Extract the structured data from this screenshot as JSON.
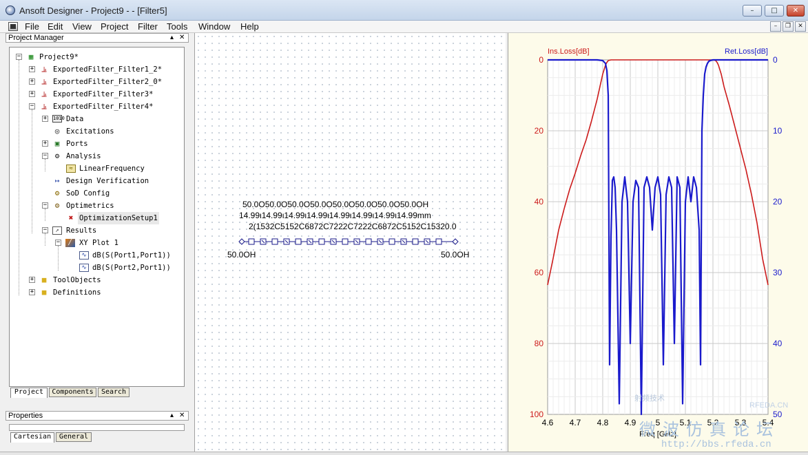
{
  "window": {
    "title": "Ansoft Designer - Project9 -  - [Filter5]"
  },
  "menu": [
    "File",
    "Edit",
    "View",
    "Project",
    "Filter",
    "Tools",
    "Window",
    "Help"
  ],
  "project_manager": {
    "title": "Project Manager",
    "tree": [
      {
        "label": "Project9*",
        "icon": "project-icon"
      },
      {
        "label": "ExportedFilter_Filter1_2*",
        "icon": "filter-icon"
      },
      {
        "label": "ExportedFilter_Filter2_0*",
        "icon": "filter-icon"
      },
      {
        "label": "ExportedFilter_Filter3*",
        "icon": "filter-icon"
      },
      {
        "label": "ExportedFilter_Filter4*",
        "icon": "filter-icon"
      },
      {
        "label": "Data",
        "icon": "data-icon"
      },
      {
        "label": "Excitations",
        "icon": "excitation-icon"
      },
      {
        "label": "Ports",
        "icon": "ports-icon"
      },
      {
        "label": "Analysis",
        "icon": "analysis-gear-icon"
      },
      {
        "label": "LinearFrequency",
        "icon": "sweep-icon"
      },
      {
        "label": "Design Verification",
        "icon": "verification-icon"
      },
      {
        "label": "SoD Config",
        "icon": "config-icon"
      },
      {
        "label": "Optimetrics",
        "icon": "optimetrics-icon"
      },
      {
        "label": "OptimizationSetup1",
        "icon": "optimization-icon"
      },
      {
        "label": "Results",
        "icon": "results-icon"
      },
      {
        "label": "XY Plot 1",
        "icon": "xy-plot-icon"
      },
      {
        "label": "dB(S(Port1,Port1))",
        "icon": "trace-icon"
      },
      {
        "label": "dB(S(Port2,Port1))",
        "icon": "trace-icon"
      },
      {
        "label": "ToolObjects",
        "icon": "folder-icon"
      },
      {
        "label": "Definitions",
        "icon": "folder-icon"
      }
    ],
    "tabs": [
      "Project",
      "Components",
      "Search"
    ]
  },
  "properties": {
    "title": "Properties",
    "tabs": [
      "Cartesian",
      "General"
    ]
  },
  "schematic": {
    "line1": "50.0O50.0O50.0O50.0O50.0O50.0O50.0O50.0OH",
    "line2": "14.99ι14.99ι14.99ι14.99ι14.99ι14.99ι14.99ι14.99mm",
    "line3": "2(1532C5152C6872C7222C7222C6872C5152C15320.0",
    "port_left": "50.0OH",
    "port_right": "50.0OH"
  },
  "chart_data": {
    "type": "line",
    "xlabel": "Freq [GHz]",
    "ylabel_left": "Ins.Loss[dB]",
    "ylabel_right": "Ret.Loss[dB]",
    "x_ticks": [
      "4.6",
      "4.7",
      "4.8",
      "4.9",
      "5",
      "5.1",
      "5.2",
      "5.3",
      "5.4"
    ],
    "y_left_ticks": [
      "0",
      "20",
      "40",
      "60",
      "80",
      "100"
    ],
    "y_right_ticks": [
      "0",
      "10",
      "20",
      "30",
      "40",
      "50"
    ],
    "xlim": [
      4.6,
      5.4
    ],
    "ylim_left": [
      0,
      100
    ],
    "ylim_right": [
      0,
      50
    ],
    "grid": true,
    "series": [
      {
        "name": "Ins.Loss[dB]",
        "color": "#cc1a1a",
        "axis": "left",
        "x": [
          4.6,
          4.62,
          4.64,
          4.66,
          4.68,
          4.7,
          4.72,
          4.74,
          4.76,
          4.78,
          4.79,
          4.8,
          4.81,
          4.815,
          4.82,
          4.83,
          5.2,
          5.21,
          5.215,
          5.22,
          5.23,
          5.24,
          5.26,
          5.28,
          5.3,
          5.32,
          5.34,
          5.36,
          5.38,
          5.4
        ],
        "y": [
          63.5,
          56,
          48,
          42,
          36.5,
          32,
          27,
          22.5,
          17,
          11,
          7.5,
          4,
          1.5,
          0.7,
          0.2,
          0,
          0,
          0.2,
          0.7,
          1.5,
          4,
          7.5,
          13,
          19,
          25,
          31,
          38,
          46,
          56,
          63.5
        ]
      },
      {
        "name": "Ret.Loss[dB]",
        "color": "#1a1acc",
        "axis": "right",
        "x": [
          4.6,
          4.78,
          4.8,
          4.81,
          4.815,
          4.82,
          4.825,
          4.83,
          4.835,
          4.84,
          4.845,
          4.85,
          4.86,
          4.87,
          4.88,
          4.89,
          4.9,
          4.91,
          4.92,
          4.93,
          4.94,
          4.95,
          4.96,
          4.97,
          4.98,
          4.99,
          5.0,
          5.01,
          5.02,
          5.03,
          5.04,
          5.05,
          5.06,
          5.07,
          5.08,
          5.09,
          5.1,
          5.11,
          5.12,
          5.13,
          5.14,
          5.15,
          5.155,
          5.16,
          5.165,
          5.17,
          5.175,
          5.18,
          5.185,
          5.19,
          5.2,
          5.22,
          5.4
        ],
        "y": [
          0,
          0,
          0.1,
          0.5,
          1.5,
          5,
          43,
          25,
          17,
          16.5,
          18,
          24,
          48.5,
          20,
          16.5,
          20,
          40,
          20,
          17,
          18,
          50,
          18,
          16.5,
          18,
          24,
          18,
          16.5,
          19,
          43,
          19,
          16.5,
          18,
          40,
          16.5,
          18,
          48.5,
          20,
          16.5,
          20,
          16.5,
          18,
          24,
          43,
          10,
          5,
          2,
          1,
          0.5,
          0.2,
          0.1,
          0,
          0,
          0
        ]
      }
    ]
  },
  "watermark": {
    "site_short": "RFEDA.CN",
    "forum_cn": "微波仿真论坛",
    "forum_url": "http://bbs.rfeda.cn",
    "site_cn": "射频技术"
  }
}
